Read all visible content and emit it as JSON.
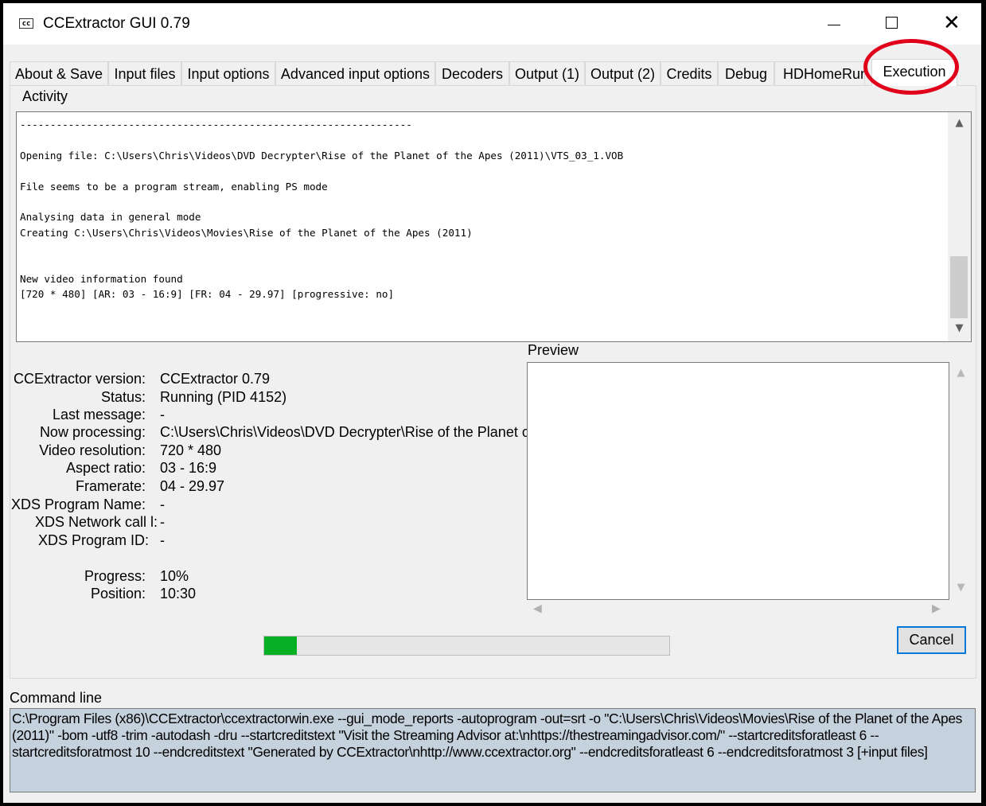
{
  "window": {
    "title": "CCExtractor GUI 0.79",
    "icon_label": "cc"
  },
  "tabs": [
    {
      "label": "About & Save"
    },
    {
      "label": "Input files"
    },
    {
      "label": "Input options"
    },
    {
      "label": "Advanced input options"
    },
    {
      "label": "Decoders"
    },
    {
      "label": "Output (1)"
    },
    {
      "label": "Output (2)"
    },
    {
      "label": "Credits"
    },
    {
      "label": "Debug"
    },
    {
      "label": "HDHomeRun"
    },
    {
      "label": "Execution",
      "active": true
    }
  ],
  "activity": {
    "label": "Activity",
    "log_lines": [
      "-----------------------------------------------------------------",
      "",
      "Opening file: C:\\Users\\Chris\\Videos\\DVD Decrypter\\Rise of the Planet of the Apes (2011)\\VTS_03_1.VOB",
      "",
      "File seems to be a program stream, enabling PS mode",
      "",
      "Analysing data in general mode",
      "Creating C:\\Users\\Chris\\Videos\\Movies\\Rise of the Planet of the Apes (2011)",
      "",
      "",
      "New video information found",
      "[720 * 480] [AR: 03 - 16:9] [FR: 04 - 29.97] [progressive: no]"
    ]
  },
  "preview": {
    "label": "Preview"
  },
  "info": [
    {
      "key": "CCExtractor version:",
      "value": "CCExtractor 0.79"
    },
    {
      "key": "Status:",
      "value": "Running (PID 4152)"
    },
    {
      "key": "Last message:",
      "value": "-"
    },
    {
      "key": "Now processing:",
      "value": "C:\\Users\\Chris\\Videos\\DVD Decrypter\\Rise of the Planet of"
    },
    {
      "key": "Video resolution:",
      "value": "720 * 480"
    },
    {
      "key": "Aspect ratio:",
      "value": "03 - 16:9"
    },
    {
      "key": "Framerate:",
      "value": "04 - 29.97"
    },
    {
      "key": "XDS Program Name:",
      "value": "-"
    },
    {
      "key": "XDS Network call l:",
      "value": "-"
    },
    {
      "key": "XDS Program ID:",
      "value": "-"
    },
    {
      "key": "Progress:",
      "value": "10%"
    },
    {
      "key": "Position:",
      "value": "10:30"
    }
  ],
  "progress": {
    "fraction": 0.08
  },
  "cancel_label": "Cancel",
  "command": {
    "label": "Command line",
    "text": "C:\\Program Files (x86)\\CCExtractor\\ccextractorwin.exe  --gui_mode_reports  -autoprogram  -out=srt -o \"C:\\Users\\Chris\\Videos\\Movies\\Rise of the Planet of the Apes (2011)\" -bom -utf8 -trim -autodash -dru --startcreditstext \"Visit the Streaming Advisor at:\\nhttps://thestreamingadvisor.com/\" --startcreditsforatleast 6 --startcreditsforatmost 10 --endcreditstext \"Generated by CCExtractor\\nhttp://www.ccextractor.org\" --endcreditsforatleast 6 --endcreditsforatmost 3 [+input files]"
  },
  "colors": {
    "progress_fill": "#06b025",
    "highlight_ring": "#e0001a",
    "command_bg": "#c5d1dc",
    "button_focus": "#0078d7"
  }
}
